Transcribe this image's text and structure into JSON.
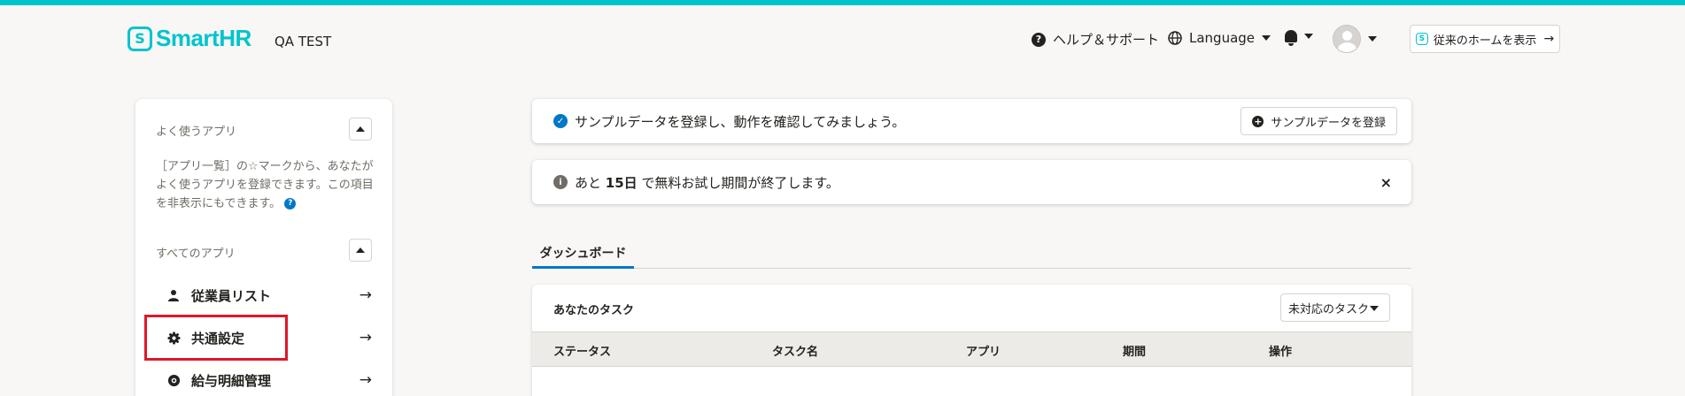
{
  "header": {
    "logo_mark": "S",
    "logo_text": "SmartHR",
    "tenant": "QA TEST",
    "help_label": "ヘルプ＆サポート",
    "language_label": "Language",
    "home_button_label": "従来のホームを表示",
    "home_arrow": "→"
  },
  "sidebar": {
    "favorites_heading": "よく使うアプリ",
    "favorites_desc": "［アプリ一覧］の☆マークから、あなたがよく使うアプリを登録できます。この項目を非表示にもできます。",
    "all_apps_heading": "すべてのアプリ",
    "items": [
      {
        "label": "従業員リスト",
        "arrow": "→"
      },
      {
        "label": "共通設定",
        "arrow": "→"
      },
      {
        "label": "給与明細管理",
        "arrow": "→"
      }
    ]
  },
  "banners": {
    "sample": {
      "message": "サンプルデータを登録し、動作を確認してみましょう。",
      "button_label": "サンプルデータを登録"
    },
    "trial": {
      "prefix": "あと ",
      "days": "15日",
      "suffix": " で無料お試し期間が終了します。",
      "close": "×"
    }
  },
  "tabs": [
    {
      "label": "ダッシュボード",
      "active": true
    }
  ],
  "tasks": {
    "title": "あなたのタスク",
    "filter_value": "未対応のタスク",
    "columns": [
      "ステータス",
      "タスク名",
      "アプリ",
      "期間",
      "操作"
    ]
  },
  "colors": {
    "brand": "#00c4cc",
    "accent_blue": "#0077c7",
    "highlight_red": "#e0162b"
  }
}
